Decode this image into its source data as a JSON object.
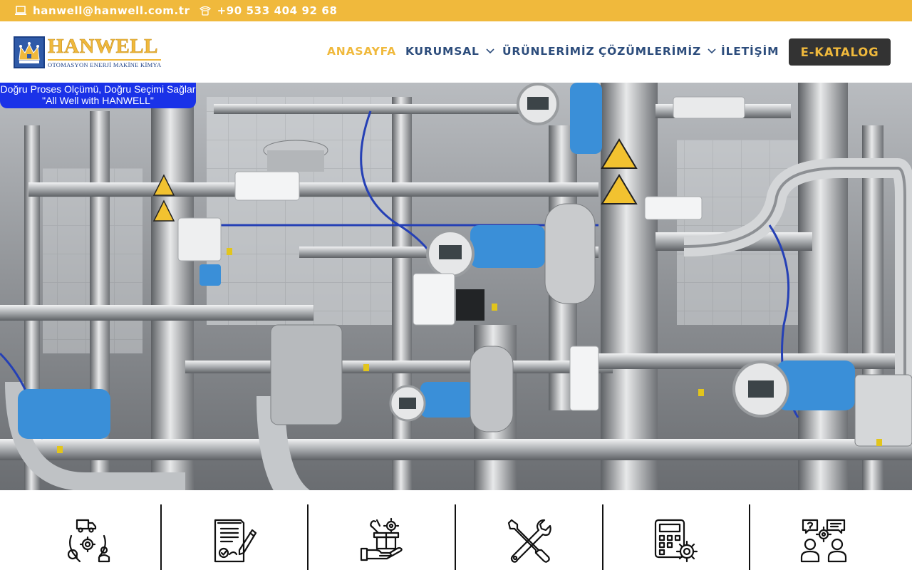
{
  "topbar": {
    "email": "hanwell@hanwell.com.tr",
    "phone": "+90 533 404 92 68",
    "email_icon": "laptop-icon",
    "phone_icon": "phone-icon"
  },
  "logo": {
    "name": "HANWELL",
    "subtitle": "OTOMASYON ENERJİ MAKİNE KİMYA"
  },
  "nav": {
    "items": [
      {
        "label": "ANASAYFA",
        "active": true,
        "dropdown": false
      },
      {
        "label": "KURUMSAL",
        "active": false,
        "dropdown": true
      },
      {
        "label": "ÜRÜNLERİMİZ",
        "active": false,
        "dropdown": false
      },
      {
        "label": "ÇÖZÜMLERİMİZ",
        "active": false,
        "dropdown": true
      },
      {
        "label": "İLETİŞİM",
        "active": false,
        "dropdown": false
      }
    ],
    "cta_label": "E-KATALOG"
  },
  "hero": {
    "slogan_line1": "Doğru Proses Olçümü, Doğru Seçimi Sağlar",
    "slogan_line2": "\"All Well with HANWELL\""
  },
  "features": {
    "icons": [
      "logistics-service-icon",
      "contract-document-icon",
      "product-support-icon",
      "tools-icon",
      "calculator-settings-icon",
      "consulting-icon"
    ]
  },
  "colors": {
    "accent": "#f0b93c",
    "nav_text": "#2d4d7c",
    "cta_bg": "#333333",
    "slogan_bg": "#1a32e8"
  }
}
